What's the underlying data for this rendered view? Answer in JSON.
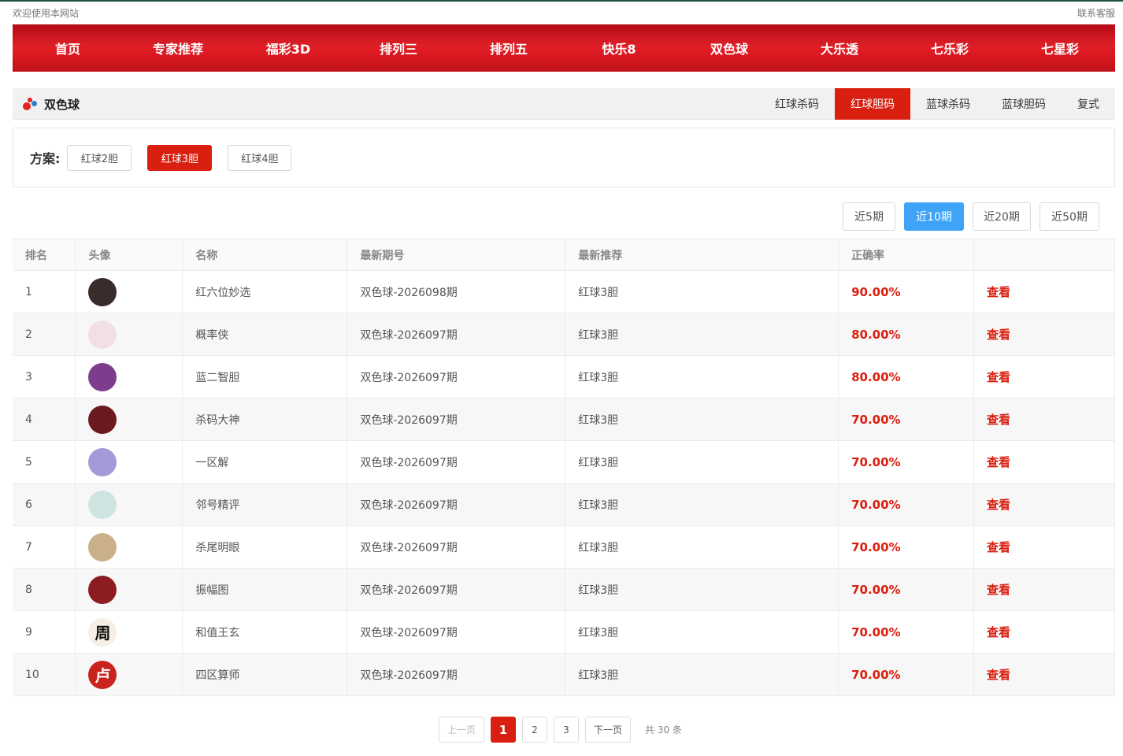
{
  "topbar": {
    "welcome": "欢迎使用本网站",
    "contact": "联系客服"
  },
  "nav": [
    "首页",
    "专家推荐",
    "福彩3D",
    "排列三",
    "排列五",
    "快乐8",
    "双色球",
    "大乐透",
    "七乐彩",
    "七星彩"
  ],
  "section": {
    "title": "双色球",
    "tabs": [
      "红球杀码",
      "红球胆码",
      "蓝球杀码",
      "蓝球胆码",
      "复式"
    ],
    "active_tab": "红球胆码"
  },
  "plan": {
    "label": "方案:",
    "options": [
      "红球2胆",
      "红球3胆",
      "红球4胆"
    ],
    "active": "红球3胆"
  },
  "periods": {
    "options": [
      "近5期",
      "近10期",
      "近20期",
      "近50期"
    ],
    "active": "近10期"
  },
  "table": {
    "headers": [
      "排名",
      "头像",
      "名称",
      "最新期号",
      "最新推荐",
      "正确率",
      ""
    ],
    "rows": [
      {
        "rank": "1",
        "name": "红六位妙选",
        "issue": "双色球-2026098期",
        "recommend": "红球3胆",
        "rate": "90.00%",
        "action": "查看",
        "avatar": {
          "glyph": "",
          "bg": "#3a2c2a",
          "fg": "#ffffff"
        }
      },
      {
        "rank": "2",
        "name": "概率侠",
        "issue": "双色球-2026097期",
        "recommend": "红球3胆",
        "rate": "80.00%",
        "action": "查看",
        "avatar": {
          "glyph": "",
          "bg": "#f2dfe6",
          "fg": "#b05a7a"
        }
      },
      {
        "rank": "3",
        "name": "蓝二智胆",
        "issue": "双色球-2026097期",
        "recommend": "红球3胆",
        "rate": "80.00%",
        "action": "查看",
        "avatar": {
          "glyph": "",
          "bg": "#7c3d8c",
          "fg": "#ffffff"
        }
      },
      {
        "rank": "4",
        "name": "杀码大神",
        "issue": "双色球-2026097期",
        "recommend": "红球3胆",
        "rate": "70.00%",
        "action": "查看",
        "avatar": {
          "glyph": "",
          "bg": "#6b1a1f",
          "fg": "#ffffff"
        }
      },
      {
        "rank": "5",
        "name": "一区解",
        "issue": "双色球-2026097期",
        "recommend": "红球3胆",
        "rate": "70.00%",
        "action": "查看",
        "avatar": {
          "glyph": "",
          "bg": "#a59ad8",
          "fg": "#ffffff"
        }
      },
      {
        "rank": "6",
        "name": "邻号精评",
        "issue": "双色球-2026097期",
        "recommend": "红球3胆",
        "rate": "70.00%",
        "action": "查看",
        "avatar": {
          "glyph": "",
          "bg": "#cfe3e0",
          "fg": "#333333"
        }
      },
      {
        "rank": "7",
        "name": "杀尾明眼",
        "issue": "双色球-2026097期",
        "recommend": "红球3胆",
        "rate": "70.00%",
        "action": "查看",
        "avatar": {
          "glyph": "",
          "bg": "#c9b08a",
          "fg": "#ffffff"
        }
      },
      {
        "rank": "8",
        "name": "振幅图",
        "issue": "双色球-2026097期",
        "recommend": "红球3胆",
        "rate": "70.00%",
        "action": "查看",
        "avatar": {
          "glyph": "",
          "bg": "#8b1c22",
          "fg": "#ffffff"
        }
      },
      {
        "rank": "9",
        "name": "和值王玄",
        "issue": "双色球-2026097期",
        "recommend": "红球3胆",
        "rate": "70.00%",
        "action": "查看",
        "avatar": {
          "glyph": "周",
          "bg": "#f6efe4",
          "fg": "#111111"
        }
      },
      {
        "rank": "10",
        "name": "四区算师",
        "issue": "双色球-2026097期",
        "recommend": "红球3胆",
        "rate": "70.00%",
        "action": "查看",
        "avatar": {
          "glyph": "卢",
          "bg": "#c8231c",
          "fg": "#ffffff"
        }
      }
    ]
  },
  "pager": {
    "prev": "上一页",
    "pages": [
      "1",
      "2",
      "3"
    ],
    "active": "1",
    "next": "下一页",
    "total": "共 30 条"
  },
  "colors": {
    "nav_red": "#d91f10",
    "period_active": "#3fa3f7"
  }
}
